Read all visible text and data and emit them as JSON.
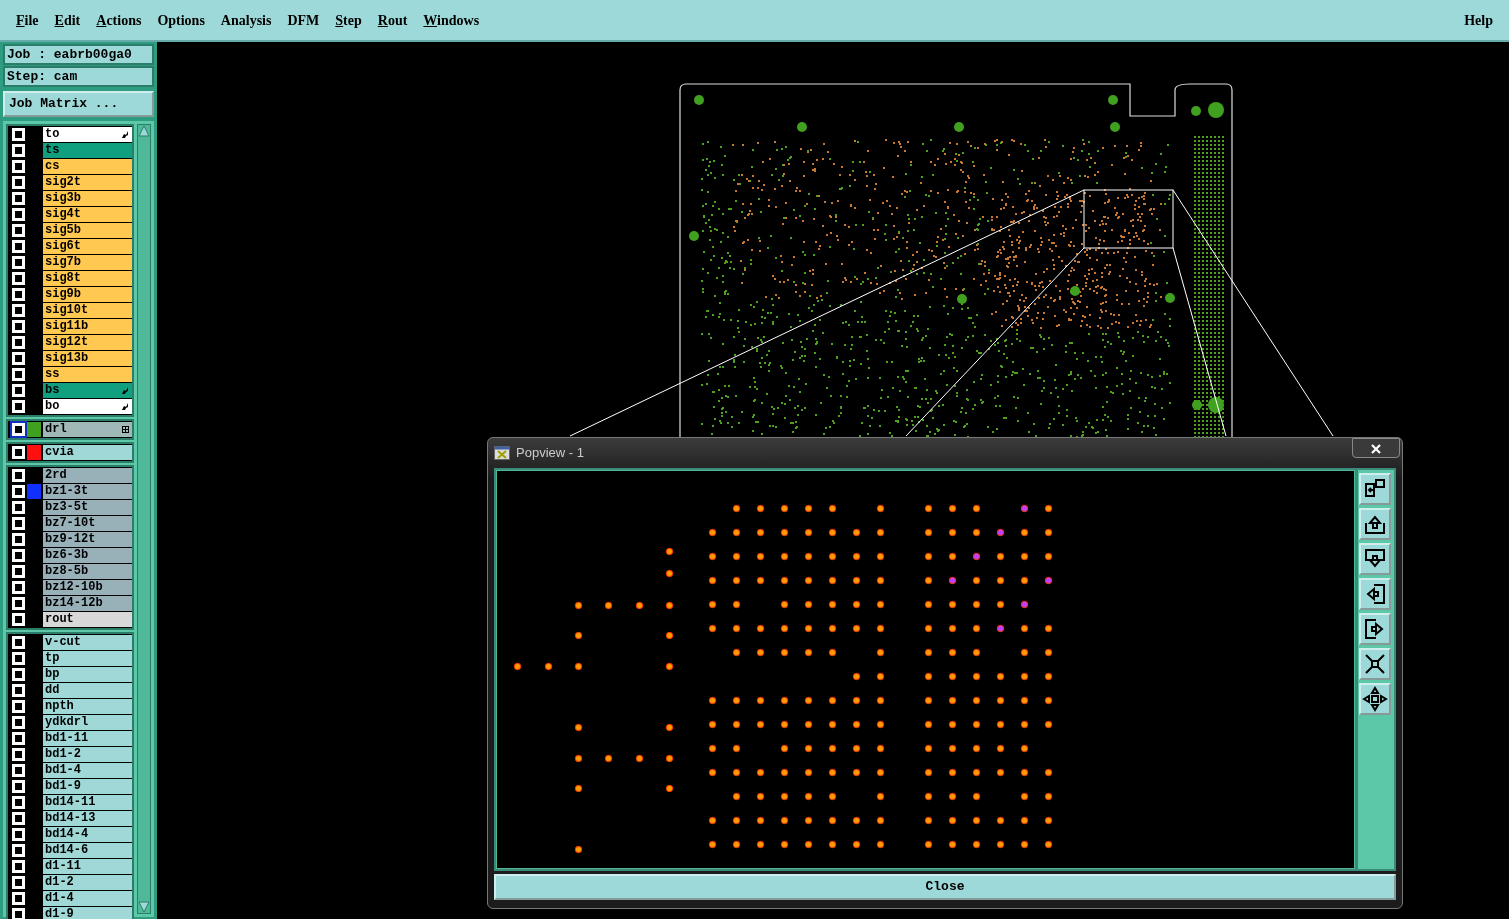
{
  "menu": [
    {
      "label": "File",
      "mnemonic": true
    },
    {
      "label": "Edit",
      "mnemonic": true
    },
    {
      "label": "Actions",
      "mnemonic": true
    },
    {
      "label": "Options",
      "mnemonic": false
    },
    {
      "label": "Analysis",
      "mnemonic": false
    },
    {
      "label": "DFM",
      "mnemonic": false
    },
    {
      "label": "Step",
      "mnemonic": true
    },
    {
      "label": "Rout",
      "mnemonic": true
    },
    {
      "label": "Windows",
      "mnemonic": true
    }
  ],
  "help": "Help",
  "job": "Job : eabrb00ga0",
  "step": "Step: cam",
  "job_matrix": "Job Matrix ...",
  "layer_groups": [
    [
      {
        "name": "to",
        "color": "#ffffff",
        "checked": false,
        "pointer": true
      },
      {
        "name": "ts",
        "color": "#10a080",
        "checked": false,
        "pointer": false
      },
      {
        "name": "cs",
        "color": "#ffc850",
        "checked": false,
        "pointer": false
      },
      {
        "name": "sig2t",
        "color": "#ffc850",
        "checked": false,
        "pointer": false
      },
      {
        "name": "sig3b",
        "color": "#ffc850",
        "checked": false,
        "pointer": false
      },
      {
        "name": "sig4t",
        "color": "#ffc850",
        "checked": false,
        "pointer": false
      },
      {
        "name": "sig5b",
        "color": "#ffc850",
        "checked": false,
        "pointer": false
      },
      {
        "name": "sig6t",
        "color": "#ffc850",
        "checked": false,
        "pointer": false
      },
      {
        "name": "sig7b",
        "color": "#ffc850",
        "checked": false,
        "pointer": false
      },
      {
        "name": "sig8t",
        "color": "#ffc850",
        "checked": false,
        "pointer": false
      },
      {
        "name": "sig9b",
        "color": "#ffc850",
        "checked": false,
        "pointer": false
      },
      {
        "name": "sig10t",
        "color": "#ffc850",
        "checked": false,
        "pointer": false
      },
      {
        "name": "sig11b",
        "color": "#ffc850",
        "checked": false,
        "pointer": false
      },
      {
        "name": "sig12t",
        "color": "#ffc850",
        "checked": false,
        "pointer": false
      },
      {
        "name": "sig13b",
        "color": "#ffc850",
        "checked": false,
        "pointer": false
      },
      {
        "name": "ss",
        "color": "#ffc850",
        "checked": false,
        "pointer": false
      },
      {
        "name": "bs",
        "color": "#10a080",
        "checked": false,
        "pointer": true
      },
      {
        "name": "bo",
        "color": "#ffffff",
        "checked": false,
        "pointer": true
      }
    ],
    [
      {
        "name": "drl",
        "color": "#a0b8b8",
        "checked": false,
        "focused": true,
        "swatch": {
          "color": "#40a020"
        },
        "grid_mark": true
      }
    ],
    [
      {
        "name": "cvia",
        "color": "#a0d8d8",
        "checked": false,
        "swatch": {
          "color": "#ff1010"
        }
      }
    ],
    [
      {
        "name": "2rd",
        "color": "#98b0b8",
        "checked": false
      },
      {
        "name": "bz1-3t",
        "color": "#98b0b8",
        "checked": false,
        "swatch": {
          "color": "#1030ff"
        }
      },
      {
        "name": "bz3-5t",
        "color": "#98b0b8",
        "checked": false
      },
      {
        "name": "bz7-10t",
        "color": "#98b0b8",
        "checked": false
      },
      {
        "name": "bz9-12t",
        "color": "#98b0b8",
        "checked": false
      },
      {
        "name": "bz6-3b",
        "color": "#98b0b8",
        "checked": false
      },
      {
        "name": "bz8-5b",
        "color": "#98b0b8",
        "checked": false
      },
      {
        "name": "bz12-10b",
        "color": "#98b0b8",
        "checked": false
      },
      {
        "name": "bz14-12b",
        "color": "#98b0b8",
        "checked": false
      },
      {
        "name": "rout",
        "color": "#d8d8d8",
        "checked": false
      }
    ],
    [
      {
        "name": "v-cut",
        "color": "#a0d8d8",
        "checked": false
      },
      {
        "name": "tp",
        "color": "#a0d8d8",
        "checked": false
      },
      {
        "name": "bp",
        "color": "#a0d8d8",
        "checked": false
      },
      {
        "name": "dd",
        "color": "#a0d8d8",
        "checked": false
      },
      {
        "name": "npth",
        "color": "#a0d8d8",
        "checked": false
      },
      {
        "name": "ydkdrl",
        "color": "#a0d8d8",
        "checked": false
      },
      {
        "name": "bd1-11",
        "color": "#a0d8d8",
        "checked": false
      },
      {
        "name": "bd1-2",
        "color": "#a0d8d8",
        "checked": false
      },
      {
        "name": "bd1-4",
        "color": "#a0d8d8",
        "checked": false
      },
      {
        "name": "bd1-9",
        "color": "#a0d8d8",
        "checked": false
      },
      {
        "name": "bd14-11",
        "color": "#a0d8d8",
        "checked": false
      },
      {
        "name": "bd14-13",
        "color": "#a0d8d8",
        "checked": false
      },
      {
        "name": "bd14-4",
        "color": "#a0d8d8",
        "checked": false
      },
      {
        "name": "bd14-6",
        "color": "#a0d8d8",
        "checked": false
      },
      {
        "name": "d1-11",
        "color": "#a0d8d8",
        "checked": false
      },
      {
        "name": "d1-2",
        "color": "#a0d8d8",
        "checked": false
      },
      {
        "name": "d1-4",
        "color": "#a0d8d8",
        "checked": false
      },
      {
        "name": "d1-9",
        "color": "#a0d8d8",
        "checked": false
      }
    ]
  ],
  "popview": {
    "title": "Popview - 1",
    "close_label": "Close"
  }
}
